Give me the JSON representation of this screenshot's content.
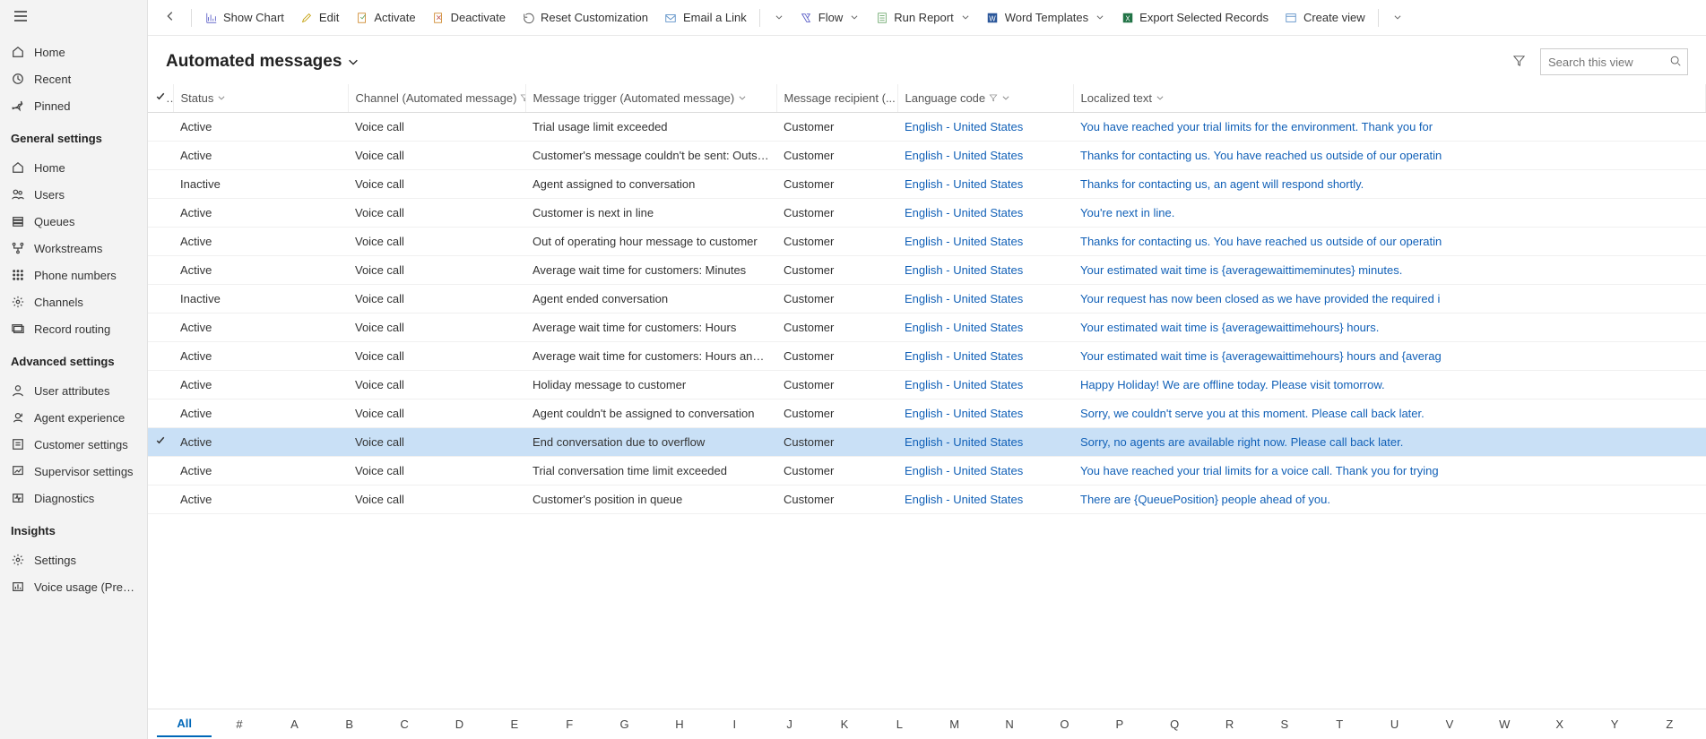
{
  "sidebar": {
    "top": [
      {
        "icon": "home",
        "label": "Home"
      },
      {
        "icon": "clock",
        "label": "Recent",
        "expandable": true
      },
      {
        "icon": "pin",
        "label": "Pinned",
        "expandable": true
      }
    ],
    "general_header": "General settings",
    "general": [
      {
        "icon": "home",
        "label": "Home"
      },
      {
        "icon": "users",
        "label": "Users"
      },
      {
        "icon": "queue",
        "label": "Queues"
      },
      {
        "icon": "workstream",
        "label": "Workstreams"
      },
      {
        "icon": "phone",
        "label": "Phone numbers"
      },
      {
        "icon": "gear",
        "label": "Channels"
      },
      {
        "icon": "route",
        "label": "Record routing"
      }
    ],
    "advanced_header": "Advanced settings",
    "advanced": [
      {
        "icon": "user",
        "label": "User attributes"
      },
      {
        "icon": "agent",
        "label": "Agent experience"
      },
      {
        "icon": "customer",
        "label": "Customer settings"
      },
      {
        "icon": "supervisor",
        "label": "Supervisor settings"
      },
      {
        "icon": "diag",
        "label": "Diagnostics"
      }
    ],
    "insights_header": "Insights",
    "insights": [
      {
        "icon": "gear",
        "label": "Settings"
      },
      {
        "icon": "voice",
        "label": "Voice usage (Preview)"
      }
    ]
  },
  "commands": {
    "show_chart": "Show Chart",
    "edit": "Edit",
    "activate": "Activate",
    "deactivate": "Deactivate",
    "reset": "Reset Customization",
    "email_link": "Email a Link",
    "flow": "Flow",
    "run_report": "Run Report",
    "word_templates": "Word Templates",
    "export": "Export Selected Records",
    "create_view": "Create view"
  },
  "view": {
    "title": "Automated messages",
    "search_placeholder": "Search this view"
  },
  "columns": {
    "status": "Status",
    "channel": "Channel (Automated message)",
    "trigger": "Message trigger (Automated message)",
    "recipient": "Message recipient (...",
    "language": "Language code",
    "localized": "Localized text"
  },
  "rows": [
    {
      "selected": false,
      "status": "Active",
      "channel": "Voice call",
      "trigger": "Trial usage limit exceeded",
      "recipient": "Customer",
      "language": "English - United States",
      "text": "You have reached your trial limits for the environment. Thank you for"
    },
    {
      "selected": false,
      "status": "Active",
      "channel": "Voice call",
      "trigger": "Customer's message couldn't be sent: Outside ...",
      "recipient": "Customer",
      "language": "English - United States",
      "text": "Thanks for contacting us. You have reached us outside of our operatin"
    },
    {
      "selected": false,
      "status": "Inactive",
      "channel": "Voice call",
      "trigger": "Agent assigned to conversation",
      "recipient": "Customer",
      "language": "English - United States",
      "text": "Thanks for contacting us, an agent will respond shortly."
    },
    {
      "selected": false,
      "status": "Active",
      "channel": "Voice call",
      "trigger": "Customer is next in line",
      "recipient": "Customer",
      "language": "English - United States",
      "text": "You're next in line."
    },
    {
      "selected": false,
      "status": "Active",
      "channel": "Voice call",
      "trigger": "Out of operating hour message to customer",
      "recipient": "Customer",
      "language": "English - United States",
      "text": "Thanks for contacting us. You have reached us outside of our operatin"
    },
    {
      "selected": false,
      "status": "Active",
      "channel": "Voice call",
      "trigger": "Average wait time for customers: Minutes",
      "recipient": "Customer",
      "language": "English - United States",
      "text": "Your estimated wait time is {averagewaittimeminutes} minutes."
    },
    {
      "selected": false,
      "status": "Inactive",
      "channel": "Voice call",
      "trigger": "Agent ended conversation",
      "recipient": "Customer",
      "language": "English - United States",
      "text": "Your request has now been closed as we have provided the required i"
    },
    {
      "selected": false,
      "status": "Active",
      "channel": "Voice call",
      "trigger": "Average wait time for customers: Hours",
      "recipient": "Customer",
      "language": "English - United States",
      "text": "Your estimated wait time is {averagewaittimehours} hours."
    },
    {
      "selected": false,
      "status": "Active",
      "channel": "Voice call",
      "trigger": "Average wait time for customers: Hours and mi...",
      "recipient": "Customer",
      "language": "English - United States",
      "text": "Your estimated wait time is {averagewaittimehours} hours and {averag"
    },
    {
      "selected": false,
      "status": "Active",
      "channel": "Voice call",
      "trigger": "Holiday message to customer",
      "recipient": "Customer",
      "language": "English - United States",
      "text": "Happy Holiday! We are offline today. Please visit tomorrow."
    },
    {
      "selected": false,
      "status": "Active",
      "channel": "Voice call",
      "trigger": "Agent couldn't be assigned to conversation",
      "recipient": "Customer",
      "language": "English - United States",
      "text": "Sorry, we couldn't serve you at this moment. Please call back later."
    },
    {
      "selected": true,
      "status": "Active",
      "channel": "Voice call",
      "trigger": "End conversation due to overflow",
      "recipient": "Customer",
      "language": "English - United States",
      "text": "Sorry, no agents are available right now. Please call back later."
    },
    {
      "selected": false,
      "status": "Active",
      "channel": "Voice call",
      "trigger": "Trial conversation time limit exceeded",
      "recipient": "Customer",
      "language": "English - United States",
      "text": "You have reached your trial limits for a voice call. Thank you for trying"
    },
    {
      "selected": false,
      "status": "Active",
      "channel": "Voice call",
      "trigger": "Customer's position in queue",
      "recipient": "Customer",
      "language": "English - United States",
      "text": "There are {QueuePosition} people ahead of you."
    }
  ],
  "alphabet": [
    "All",
    "#",
    "A",
    "B",
    "C",
    "D",
    "E",
    "F",
    "G",
    "H",
    "I",
    "J",
    "K",
    "L",
    "M",
    "N",
    "O",
    "P",
    "Q",
    "R",
    "S",
    "T",
    "U",
    "V",
    "W",
    "X",
    "Y",
    "Z"
  ],
  "alpha_active": "All"
}
